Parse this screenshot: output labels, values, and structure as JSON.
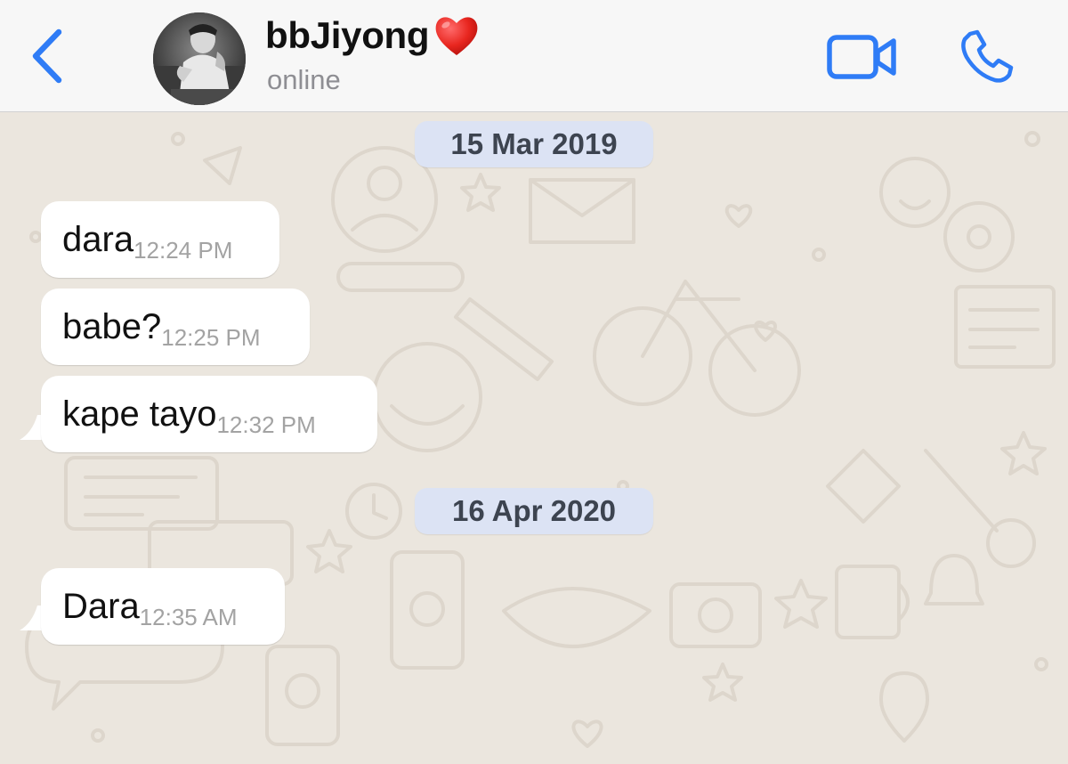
{
  "header": {
    "contact_name": "bbJiyong",
    "status": "online",
    "heart_emoji": "❤️",
    "accent_color": "#2f7cf6"
  },
  "icons": {
    "back": "chevron-left-icon",
    "video": "video-camera-icon",
    "call": "phone-icon"
  },
  "chat": {
    "dates": [
      {
        "label": "15 Mar 2019"
      },
      {
        "label": "16 Apr 2020"
      }
    ],
    "messages": [
      {
        "text": "dara",
        "time": "12:24 PM"
      },
      {
        "text": "babe?",
        "time": "12:25 PM"
      },
      {
        "text": "kape tayo",
        "time": "12:32 PM"
      },
      {
        "text": "Dara",
        "time": "12:35 AM"
      }
    ]
  }
}
